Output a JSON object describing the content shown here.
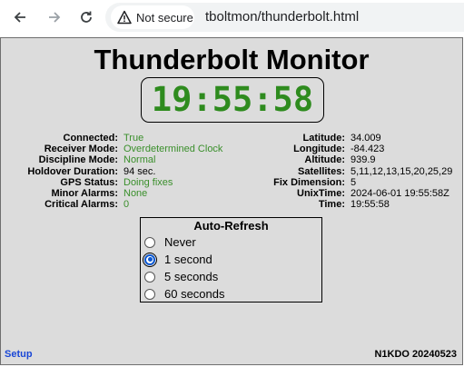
{
  "browser": {
    "security_label": "Not secure",
    "url": "tboltmon/thunderbolt.html",
    "icons": [
      "back-arrow-icon",
      "forward-arrow-icon",
      "reload-icon",
      "warning-icon"
    ]
  },
  "page": {
    "title": "Thunderbolt Monitor",
    "clock": "19:55:58",
    "status_left": [
      {
        "label": "Connected:",
        "value": "True"
      },
      {
        "label": "Receiver Mode:",
        "value": "Overdetermined Clock"
      },
      {
        "label": "Discipline Mode:",
        "value": "Normal"
      },
      {
        "label": "Holdover Duration:",
        "value": "94 sec."
      },
      {
        "label": "GPS Status:",
        "value": "Doing fixes"
      },
      {
        "label": "Minor Alarms:",
        "value": "None"
      },
      {
        "label": "Critical Alarms:",
        "value": "0"
      }
    ],
    "status_right": [
      {
        "label": "Latitude:",
        "value": "34.009"
      },
      {
        "label": "Longitude:",
        "value": "-84.423"
      },
      {
        "label": "Altitude:",
        "value": "939.9"
      },
      {
        "label": "Satellites:",
        "value": "5,11,12,13,15,20,25,29"
      },
      {
        "label": "Fix Dimension:",
        "value": "5"
      },
      {
        "label": "UnixTime:",
        "value": "2024-06-01 19:55:58Z"
      },
      {
        "label": "Time:",
        "value": "19:55:58"
      }
    ],
    "auto_refresh": {
      "title": "Auto-Refresh",
      "options": [
        "Never",
        "1 second",
        "5 seconds",
        "60 seconds"
      ],
      "selected": "1 second"
    },
    "setup_link": "Setup",
    "version": "N1KDO 20240523",
    "colors": {
      "clock": "#2e8b1e",
      "value_green": "#3a8f2b",
      "link": "#1a47d6",
      "background": "#dcdcdc"
    }
  }
}
